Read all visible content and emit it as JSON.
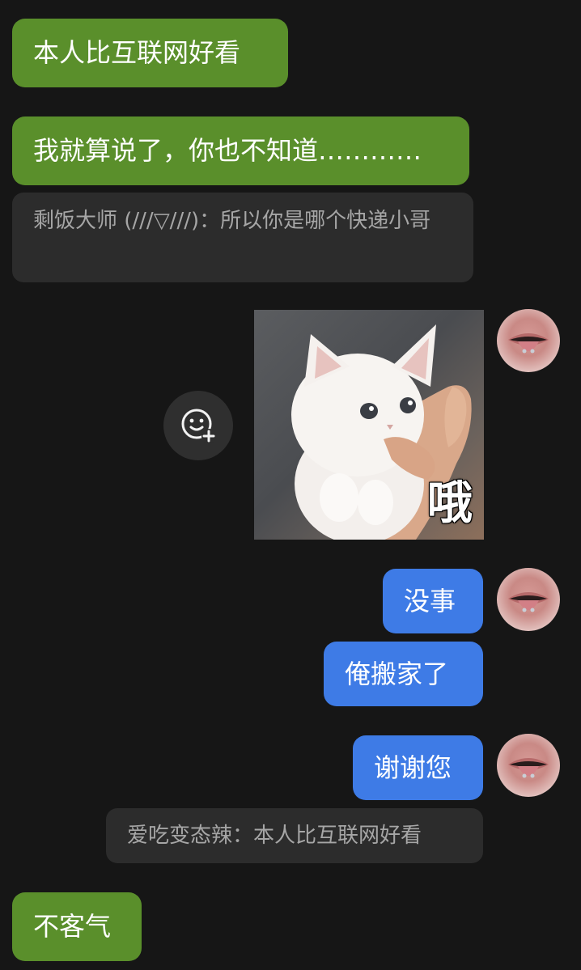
{
  "messages": [
    {
      "text": "本人比互联网好看"
    },
    {
      "text": "我就算说了，你也不知道…………"
    },
    {
      "quote": "剩饭大师 (///▽///)：所以你是哪个快递小哥"
    },
    {
      "sticker_caption": "哦"
    },
    {
      "text": "没事"
    },
    {
      "text": "俺搬家了"
    },
    {
      "text": "谢谢您"
    },
    {
      "quote": "爱吃变态辣：本人比互联网好看"
    },
    {
      "text": "不客气"
    }
  ],
  "colors": {
    "background": "#161616",
    "incoming_bubble": "#5a8f2b",
    "outgoing_bubble": "#3e7be6",
    "quote_bubble": "#2c2c2c",
    "quote_text": "#a6a6a6"
  },
  "icons": {
    "add_emoji": "add-emoji-icon",
    "avatar": "avatar-image"
  }
}
